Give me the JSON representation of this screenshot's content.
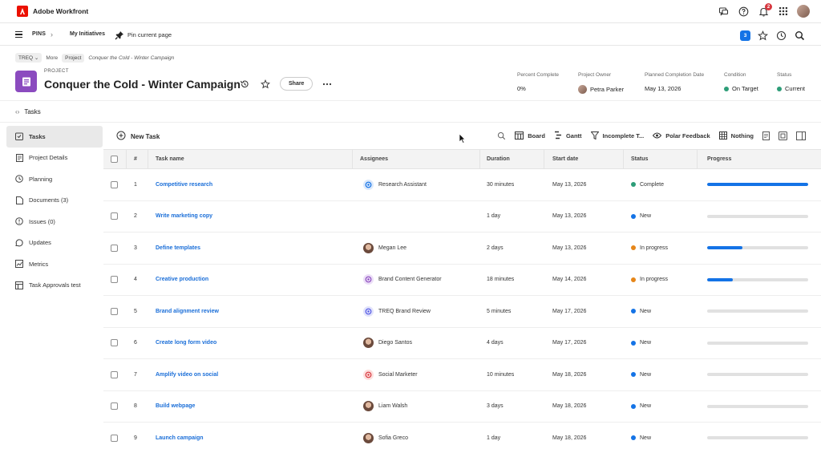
{
  "app": {
    "name": "Adobe Workfront",
    "notification_count": "2"
  },
  "nav": {
    "pins": "PINS",
    "initiatives": "My Initiatives",
    "pin_page": "Pin current page",
    "count_badge": "3"
  },
  "breadcrumbs": {
    "org": "TREQ",
    "more": "More",
    "type": "Project",
    "current": "Conquer the Cold - Winter Campaign"
  },
  "project": {
    "type_label": "PROJECT",
    "title": "Conquer the Cold - Winter Campaign",
    "share_label": "Share",
    "meta": {
      "percent_label": "Percent Complete",
      "percent_value": "0%",
      "owner_label": "Project Owner",
      "owner_value": "Petra Parker",
      "planned_label": "Planned Completion Date",
      "planned_value": "May 13, 2026",
      "condition_label": "Condition",
      "condition_value": "On Target",
      "status_label": "Status",
      "status_value": "Current"
    }
  },
  "section_title": "Tasks",
  "leftnav": [
    {
      "label": "Tasks",
      "icon": "tasks-icon"
    },
    {
      "label": "Project Details",
      "icon": "details-icon"
    },
    {
      "label": "Planning",
      "icon": "planning-icon"
    },
    {
      "label": "Documents (3)",
      "icon": "documents-icon"
    },
    {
      "label": "Issues (0)",
      "icon": "issues-icon"
    },
    {
      "label": "Updates",
      "icon": "updates-icon"
    },
    {
      "label": "Metrics",
      "icon": "metrics-icon"
    },
    {
      "label": "Task Approvals test",
      "icon": "approvals-icon"
    }
  ],
  "toolbar": {
    "new_task": "New Task",
    "board": "Board",
    "gantt": "Gantt",
    "filter": "Incomplete T...",
    "view": "Polar Feedback",
    "grouping": "Nothing"
  },
  "table": {
    "headers": {
      "num": "#",
      "name": "Task name",
      "assignees": "Assignees",
      "duration": "Duration",
      "start": "Start date",
      "status": "Status",
      "progress": "Progress"
    },
    "rows": [
      {
        "num": "1",
        "name": "Competitive research",
        "assignee": "Research Assistant",
        "assignee_kind": "agent-blue",
        "duration": "30 minutes",
        "start": "May 13, 2026",
        "status": "Complete",
        "status_color": "#2d9d78",
        "progress": 1.0
      },
      {
        "num": "2",
        "name": "Write marketing copy",
        "assignee": "",
        "assignee_kind": "none",
        "duration": "1 day",
        "start": "May 13, 2026",
        "status": "New",
        "status_color": "#1473e6",
        "progress": 0.0
      },
      {
        "num": "3",
        "name": "Define templates",
        "assignee": "Megan Lee",
        "assignee_kind": "person",
        "duration": "2 days",
        "start": "May 13, 2026",
        "status": "In progress",
        "status_color": "#e68619",
        "progress": 0.35
      },
      {
        "num": "4",
        "name": "Creative production",
        "assignee": "Brand Content Generator",
        "assignee_kind": "agent-purple",
        "duration": "18 minutes",
        "start": "May 14, 2026",
        "status": "In progress",
        "status_color": "#e68619",
        "progress": 0.25
      },
      {
        "num": "5",
        "name": "Brand alignment review",
        "assignee": "TREQ Brand Review",
        "assignee_kind": "agent-indigo",
        "duration": "5 minutes",
        "start": "May 17, 2026",
        "status": "New",
        "status_color": "#1473e6",
        "progress": 0.0
      },
      {
        "num": "6",
        "name": "Create long form video",
        "assignee": "Diego Santos",
        "assignee_kind": "person",
        "duration": "4 days",
        "start": "May 17, 2026",
        "status": "New",
        "status_color": "#1473e6",
        "progress": 0.0
      },
      {
        "num": "7",
        "name": "Amplify video on social",
        "assignee": "Social Marketer",
        "assignee_kind": "agent-red",
        "duration": "10 minutes",
        "start": "May 18, 2026",
        "status": "New",
        "status_color": "#1473e6",
        "progress": 0.0
      },
      {
        "num": "8",
        "name": "Build webpage",
        "assignee": "Liam Walsh",
        "assignee_kind": "person",
        "duration": "3 days",
        "start": "May 18, 2026",
        "status": "New",
        "status_color": "#1473e6",
        "progress": 0.0
      },
      {
        "num": "9",
        "name": "Launch campaign",
        "assignee": "Sofia Greco",
        "assignee_kind": "person",
        "duration": "1 day",
        "start": "May 18, 2026",
        "status": "New",
        "status_color": "#1473e6",
        "progress": 0.0
      }
    ]
  }
}
